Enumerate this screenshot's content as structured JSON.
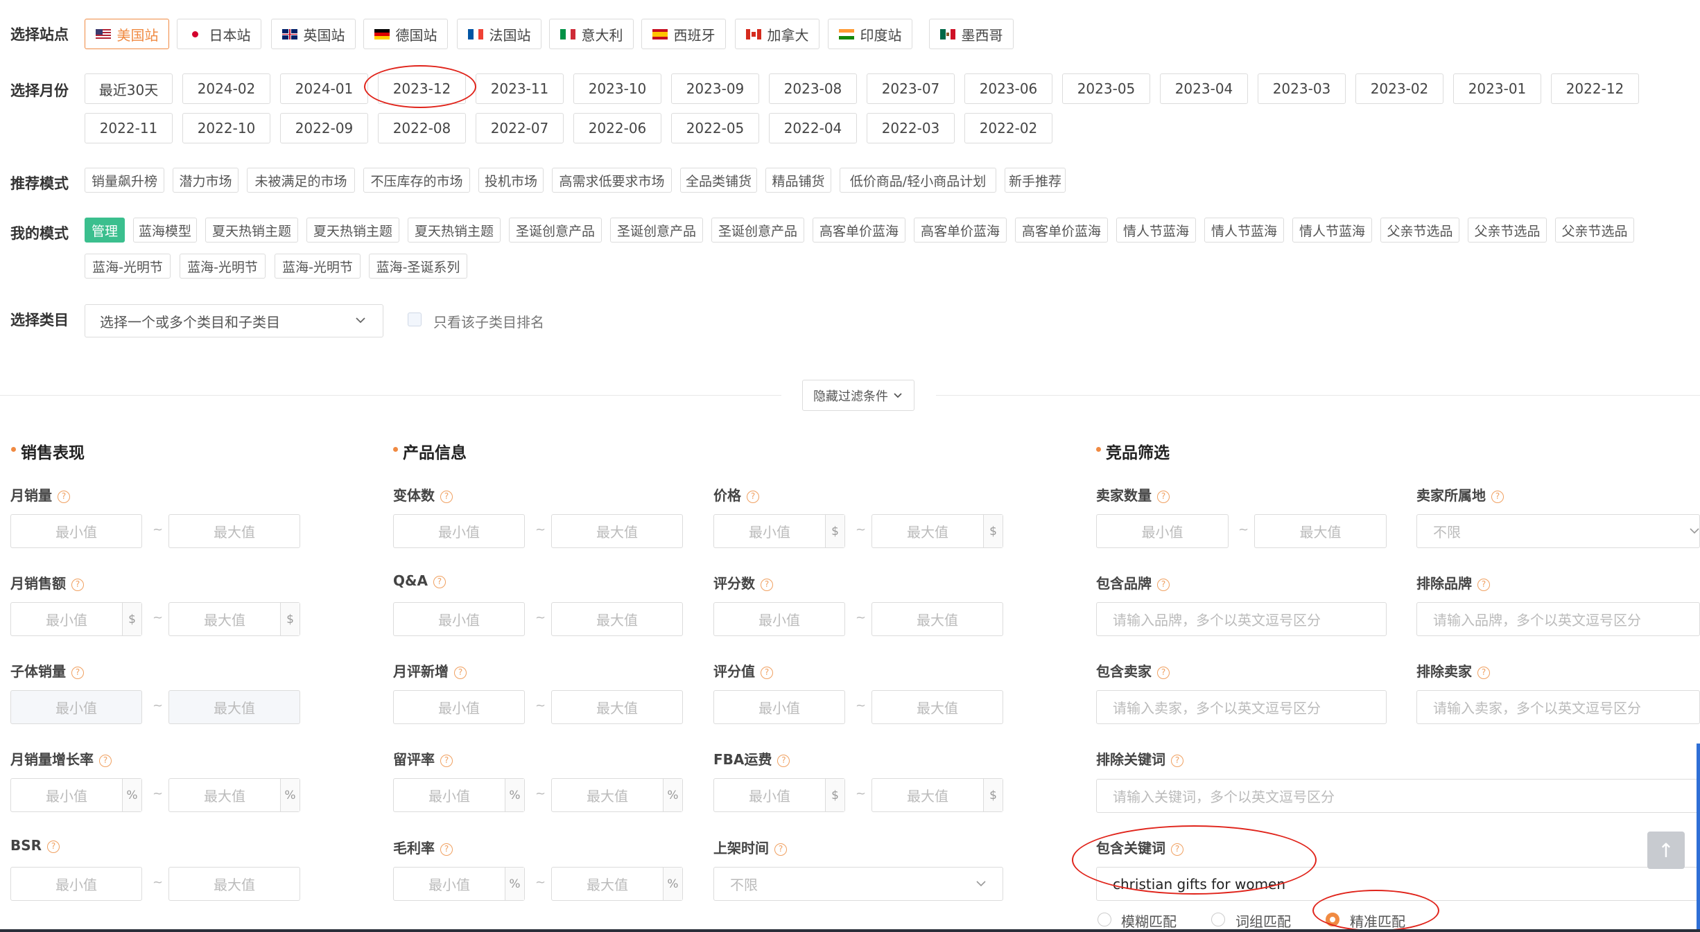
{
  "site": {
    "label": "选择站点",
    "items": [
      {
        "name": "美国站",
        "flag": "us",
        "active": true
      },
      {
        "name": "日本站",
        "flag": "jp"
      },
      {
        "name": "英国站",
        "flag": "uk"
      },
      {
        "name": "德国站",
        "flag": "de"
      },
      {
        "name": "法国站",
        "flag": "fr"
      },
      {
        "name": "意大利",
        "flag": "it"
      },
      {
        "name": "西班牙",
        "flag": "es"
      },
      {
        "name": "加拿大",
        "flag": "ca"
      },
      {
        "name": "印度站",
        "flag": "in"
      },
      {
        "name": "墨西哥",
        "flag": "mx"
      }
    ]
  },
  "month": {
    "label": "选择月份",
    "row1": [
      "最近30天",
      "2024-02",
      "2024-01",
      "2023-12",
      "2023-11",
      "2023-10",
      "2023-09",
      "2023-08",
      "2023-07",
      "2023-06",
      "2023-05",
      "2023-04",
      "2023-03",
      "2023-02",
      "2023-01",
      "2022-12"
    ],
    "row2": [
      "2022-11",
      "2022-10",
      "2022-09",
      "2022-08",
      "2022-07",
      "2022-06",
      "2022-05",
      "2022-04",
      "2022-03",
      "2022-02"
    ],
    "selected": "2023-12"
  },
  "recommend": {
    "label": "推荐模式",
    "items": [
      "销量飙升榜",
      "潜力市场",
      "未被满足的市场",
      "不压库存的市场",
      "投机市场",
      "高需求低要求市场",
      "全品类铺货",
      "精品铺货",
      "低价商品/轻小商品计划",
      "新手推荐"
    ]
  },
  "my_mode": {
    "label": "我的模式",
    "row1": [
      "管理",
      "蓝海模型",
      "夏天热销主题",
      "夏天热销主题",
      "夏天热销主题",
      "圣诞创意产品",
      "圣诞创意产品",
      "圣诞创意产品",
      "高客单价蓝海",
      "高客单价蓝海",
      "高客单价蓝海",
      "情人节蓝海",
      "情人节蓝海",
      "情人节蓝海",
      "父亲节选品",
      "父亲节选品",
      "父亲节选品"
    ],
    "row2": [
      "蓝海-光明节",
      "蓝海-光明节",
      "蓝海-光明节",
      "蓝海-圣诞系列"
    ]
  },
  "category": {
    "label": "选择类目",
    "placeholder": "选择一个或多个类目和子类目",
    "checkbox_label": "只看该子类目排名"
  },
  "hide_filters": "隐藏过滤条件",
  "sections": {
    "sales": "销售表现",
    "product": "产品信息",
    "competition": "竞品筛选"
  },
  "placeholders": {
    "min": "最小值",
    "max": "最大值",
    "tilde": "~",
    "unlimited": "不限"
  },
  "units": {
    "dollar": "$",
    "percent": "%"
  },
  "sales_fields": [
    "月销量",
    "月销售额",
    "子体销量",
    "月销量增长率",
    "BSR"
  ],
  "product_fields": [
    "变体数",
    "Q&A",
    "月评新增",
    "留评率",
    "毛利率"
  ],
  "product_fields2": [
    "价格",
    "评分数",
    "评分值",
    "FBA运费",
    "上架时间"
  ],
  "competition": {
    "seller_count": "卖家数量",
    "seller_location": "卖家所属地",
    "include_brand": "包含品牌",
    "include_brand_ph": "请输入品牌，多个以英文逗号区分",
    "exclude_brand": "排除品牌",
    "exclude_brand_ph": "请输入品牌，多个以英文逗号区分",
    "include_seller": "包含卖家",
    "include_seller_ph": "请输入卖家，多个以英文逗号区分",
    "exclude_seller": "排除卖家",
    "exclude_seller_ph": "请输入卖家，多个以英文逗号区分",
    "exclude_keyword": "排除关键词",
    "exclude_keyword_ph": "请输入关键词，多个以英文逗号区分",
    "include_keyword": "包含关键词",
    "include_keyword_value": "christian gifts for women",
    "match_options": [
      "模糊匹配",
      "词组匹配",
      "精准匹配"
    ],
    "match_selected": "精准匹配"
  },
  "icons": {
    "help": "?",
    "scroll_top": "↑"
  },
  "colors": {
    "accent": "#f08a42",
    "green": "#3bbf8e",
    "annotation": "#e0241b"
  }
}
